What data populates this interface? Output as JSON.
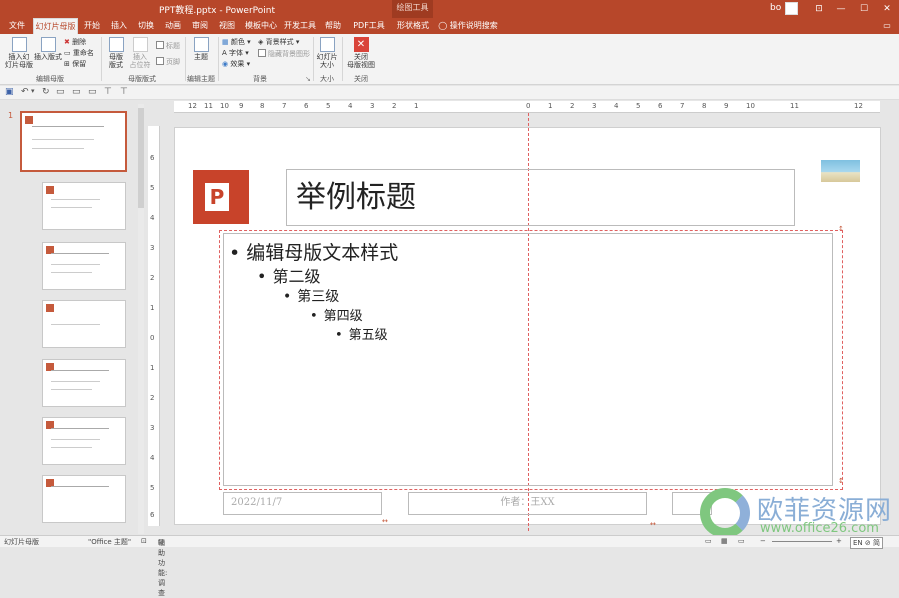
{
  "window": {
    "title": "PPT教程.pptx  -  PowerPoint",
    "contextual_tools": "绘图工具",
    "user": "bo",
    "controls": {
      "ribbon_options": "⊡",
      "minimize": "—",
      "maximize": "☐",
      "close": "✕"
    }
  },
  "tabs": [
    {
      "label": "文件"
    },
    {
      "label": "幻灯片母版"
    },
    {
      "label": "开始"
    },
    {
      "label": "插入"
    },
    {
      "label": "切换"
    },
    {
      "label": "动画"
    },
    {
      "label": "审阅"
    },
    {
      "label": "视图"
    },
    {
      "label": "模板中心"
    },
    {
      "label": "开发工具"
    },
    {
      "label": "帮助"
    },
    {
      "label": "PDF工具集"
    },
    {
      "label": "形状格式"
    },
    {
      "label": "操作说明搜索"
    }
  ],
  "ribbon": {
    "insert_master": "插入幻\n灯片母版",
    "insert_layout": "插入版式",
    "delete": "删除",
    "rename": "重命名",
    "preserve": "保留",
    "group_edit_master": "编辑母版",
    "master_layout": "母版\n版式",
    "insert_placeholder": "插入\n占位符",
    "title_cb": "标题",
    "footer_cb": "页脚",
    "group_master_layout": "母版版式",
    "theme": "主题",
    "group_edit_theme": "编辑主题",
    "colors": "颜色",
    "fonts": "字体",
    "effects": "效果",
    "bg_styles": "背景样式",
    "hide_bg": "隐藏背景图形",
    "group_background": "背景",
    "slide_size": "幻灯片\n大小",
    "group_size": "大小",
    "close_master": "关闭\n母版视图",
    "group_close": "关闭"
  },
  "slide_number": "1",
  "ruler_h": [
    "12",
    "11",
    "10",
    "9",
    "8",
    "7",
    "6",
    "5",
    "4",
    "3",
    "2",
    "1",
    "0",
    "1",
    "2",
    "3",
    "4",
    "5",
    "6",
    "7",
    "8",
    "9",
    "10",
    "11",
    "12"
  ],
  "ruler_v": [
    "6",
    "5",
    "4",
    "3",
    "2",
    "1",
    "0",
    "1",
    "2",
    "3",
    "4",
    "5",
    "6"
  ],
  "slide": {
    "title": "举例标题",
    "body": [
      {
        "level": 1,
        "text": "编辑母版文本样式"
      },
      {
        "level": 2,
        "text": "第二级"
      },
      {
        "level": 3,
        "text": "第三级"
      },
      {
        "level": 4,
        "text": "第四级"
      },
      {
        "level": 5,
        "text": "第五级"
      }
    ],
    "date": "2022/11/7",
    "footer": "作者：王XX"
  },
  "statusbar": {
    "view": "幻灯片母版",
    "theme": "\"Office 主题\"",
    "accessibility": "辅助功能: 调查",
    "lang": "EN ⊘ 简"
  },
  "watermark": {
    "name": "欧菲资源网",
    "url": "www.office26.com"
  },
  "colors": {
    "accent": "#b7472a",
    "selection": "#c55a3c"
  }
}
